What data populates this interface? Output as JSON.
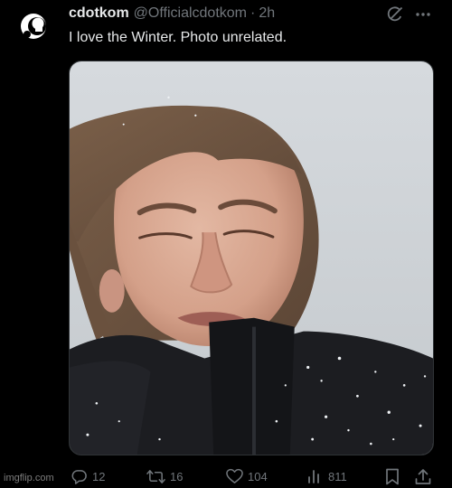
{
  "tweet": {
    "author_name": "cdotkom",
    "handle": "@Officialcdotkom",
    "separator": "·",
    "time": "2h",
    "text": "I love the Winter. Photo unrelated.",
    "media_icon": "photo-of-man-in-snow"
  },
  "header_icons": {
    "grok": "grok-icon",
    "more": "more-icon"
  },
  "actions": {
    "replies": "12",
    "reposts": "16",
    "likes": "104",
    "views": "811"
  },
  "action_icons": [
    "reply-icon",
    "repost-icon",
    "like-icon",
    "views-icon",
    "bookmark-icon",
    "share-icon"
  ],
  "watermark": "imgflip.com",
  "colors": {
    "background": "#000000",
    "primary_text": "#e7e9ea",
    "secondary_text": "#71767b",
    "border": "#2f3336"
  }
}
